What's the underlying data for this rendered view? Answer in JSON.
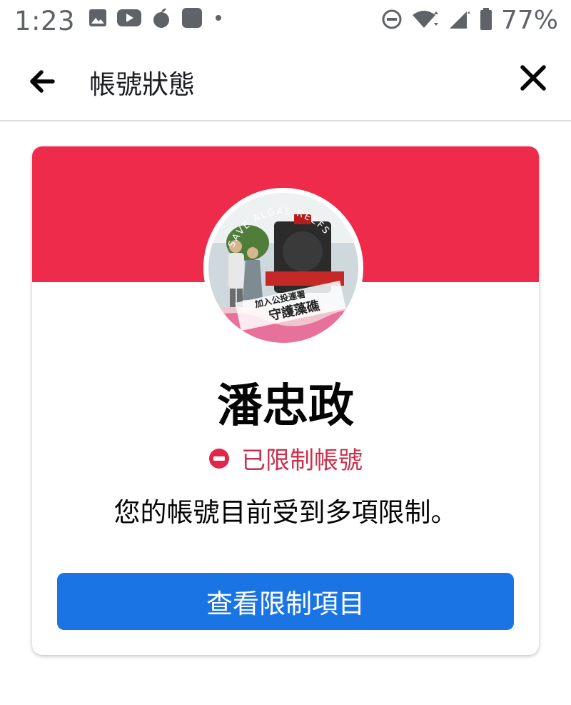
{
  "status_bar": {
    "time": "1:23",
    "battery": "77%",
    "left_icons": [
      "image-icon",
      "youtube-icon",
      "apple-app-icon",
      "app-square-icon",
      "dot-icon"
    ],
    "right_icons": [
      "do-not-disturb-icon",
      "wifi-icon",
      "signal-icon",
      "battery-icon"
    ]
  },
  "app_bar": {
    "title": "帳號狀態",
    "back_icon": "back-arrow-icon",
    "close_icon": "close-icon"
  },
  "card": {
    "banner_color": "#ee2b4b",
    "avatar_badge_top": "SAVE ALGAE REEFS",
    "avatar_caption_1": "加入公投連署",
    "avatar_caption_2": "守護藻礁",
    "name": "潘忠政",
    "status_label": "已限制帳號",
    "status_color": "#c9314d",
    "description": "您的帳號目前受到多項限制。",
    "button_label": "查看限制項目",
    "button_color": "#1b74e4"
  }
}
